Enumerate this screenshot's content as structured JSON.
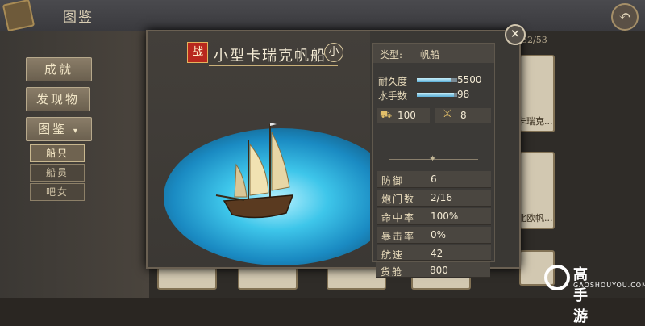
{
  "header": {
    "title": "图鉴"
  },
  "nav": {
    "achievement": "成就",
    "discovery": "发现物",
    "codex": "图鉴",
    "sub_ships": "船只",
    "sub_crew": "船员",
    "sub_maid": "吧女"
  },
  "bg": {
    "page_count": "52/53",
    "card_label_1": "卡瑞克...",
    "card_label_2": "北欧帆..."
  },
  "ship": {
    "war_badge": "战",
    "name": "小型卡瑞克帆船",
    "size_badge": "小",
    "type_label": "类型:",
    "type_value": "帆船",
    "durability_label": "耐久度",
    "durability_value": "5500",
    "durability_fill": 0.85,
    "sailors_label": "水手数",
    "sailors_value": "98",
    "sailors_fill": 0.92,
    "cargo_small": "100",
    "cannon_small": "8",
    "stats": [
      {
        "label": "防御",
        "value": "6"
      },
      {
        "label": "炮门数",
        "value": "2/16"
      },
      {
        "label": "命中率",
        "value": "100%"
      },
      {
        "label": "暴击率",
        "value": "0%"
      },
      {
        "label": "航速",
        "value": "42"
      },
      {
        "label": "货舱",
        "value": "800"
      }
    ]
  },
  "watermark": {
    "brand": "高手游",
    "domain": "GAOSHOUYOU.COM"
  }
}
